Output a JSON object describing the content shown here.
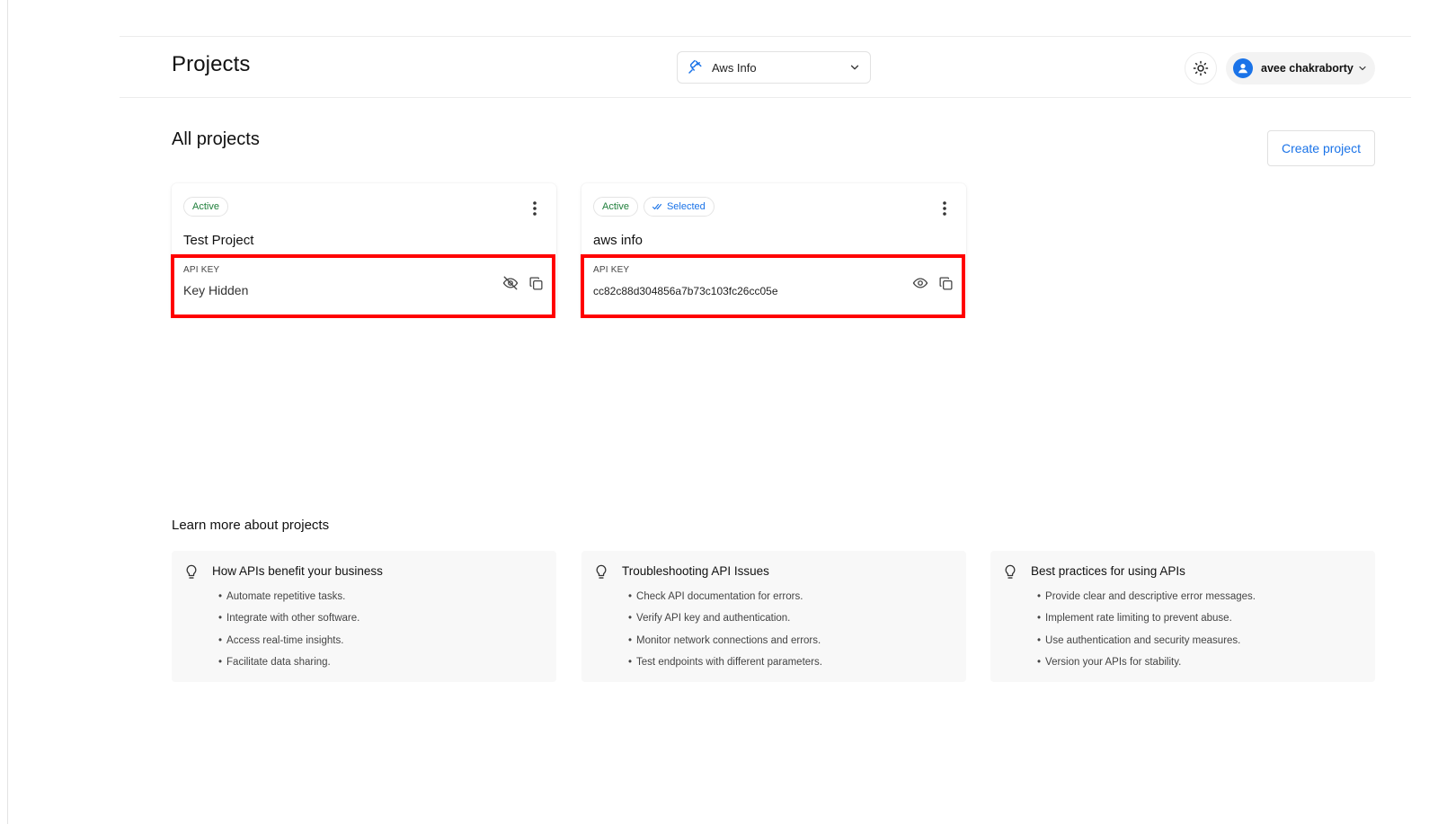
{
  "header": {
    "title": "Projects",
    "project_selector": {
      "selected": "Aws Info"
    },
    "user": {
      "name": "avee chakraborty"
    }
  },
  "main": {
    "section_title": "All projects",
    "create_button": "Create project",
    "projects": [
      {
        "status": "Active",
        "selected": null,
        "name": "Test Project",
        "api_key_label": "API KEY",
        "api_key_value": "Key Hidden",
        "key_visible": false
      },
      {
        "status": "Active",
        "selected": "Selected",
        "name": "aws info",
        "api_key_label": "API KEY",
        "api_key_value": "cc82c88d304856a7b73c103fc26cc05e",
        "key_visible": true
      }
    ]
  },
  "learn": {
    "title": "Learn more about projects",
    "cards": [
      {
        "title": "How APIs benefit your business",
        "items": [
          "Automate repetitive tasks.",
          "Integrate with other software.",
          "Access real-time insights.",
          "Facilitate data sharing."
        ]
      },
      {
        "title": "Troubleshooting API Issues",
        "items": [
          "Check API documentation for errors.",
          "Verify API key and authentication.",
          "Monitor network connections and errors.",
          "Test endpoints with different parameters."
        ]
      },
      {
        "title": "Best practices for using APIs",
        "items": [
          "Provide clear and descriptive error messages.",
          "Implement rate limiting to prevent abuse.",
          "Use authentication and security measures.",
          "Version your APIs for stability."
        ]
      }
    ]
  },
  "colors": {
    "accent": "#1a73e8",
    "active_green": "#1e7e3a",
    "highlight_red": "#ff0000"
  },
  "icons": {
    "plug": "plug-icon",
    "theme": "sun-icon",
    "eye_hidden": "eye-off-icon",
    "eye": "eye-icon",
    "copy": "copy-icon",
    "more": "kebab-icon",
    "tip": "lightbulb-icon"
  }
}
